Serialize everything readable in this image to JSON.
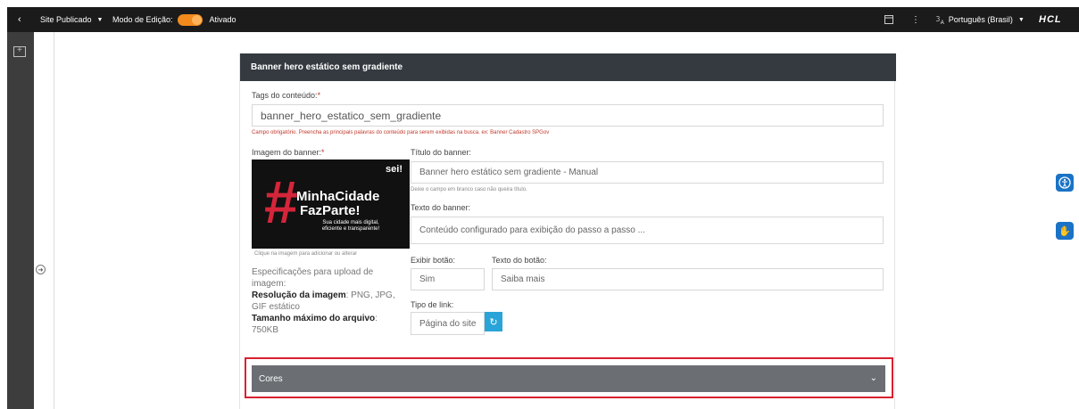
{
  "topbar": {
    "back_icon": "chevron-left-icon",
    "site_label": "Site Publicado",
    "edit_mode_label": "Modo de Edição:",
    "edit_mode_state": "Ativado",
    "language_label": "Português (Brasil)",
    "brand_logo": "HCL",
    "accent_color": "#f28a1d"
  },
  "panel": {
    "title": "Banner hero estático sem gradiente",
    "tags": {
      "label": "Tags do conteúdo:",
      "required_mark": "*",
      "value": "banner_hero_estatico_sem_gradiente",
      "hint": "Campo obrigatório. Preencha as principais palavras do conteúdo para serem exibidas na busca. ex: Banner Cadastro SPGov"
    },
    "image": {
      "label": "Imagem do banner:",
      "required_mark": "*",
      "banner_hash": "#",
      "banner_title_1": "MinhaCidade",
      "banner_title_2": "FazParte!",
      "banner_subtitle_1": "Sua cidade mais digital,",
      "banner_subtitle_2": "eficiente e transparente!",
      "banner_logo": "sei!",
      "caption": "Clique na imagem para adicionar ou alterar"
    },
    "spec": {
      "intro_1": "Especificações para upload de",
      "intro_2": "imagem:",
      "resolution_label": "Resolução da imagem",
      "resolution_value_1": ": PNG, JPG,",
      "resolution_value_2": "GIF estático",
      "max_size_label_1": "Tamanho máximo do arquivo",
      "max_size_value_inline": ":",
      "max_size_value": "750KB"
    },
    "banner_title": {
      "label": "Título do banner:",
      "value": "Banner hero estático sem gradiente - Manual",
      "hint": "Deixe o campo em branco caso não queira título."
    },
    "banner_text": {
      "label": "Texto do banner:",
      "value": "Conteúdo configurado para exibição do passo a passo ..."
    },
    "show_button": {
      "label": "Exibir botão:",
      "value": "Sim"
    },
    "button_text": {
      "label": "Texto do botão:",
      "value": "Saiba mais"
    },
    "link_type": {
      "label": "Tipo de link:",
      "value": "Página do site",
      "refresh_icon": "refresh-icon"
    },
    "cores": {
      "label": "Cores",
      "highlight_color": "#d9212f"
    }
  },
  "floating": {
    "accessibility_icon": "accessibility-icon",
    "sign_language_icon": "sign-language-icon"
  }
}
